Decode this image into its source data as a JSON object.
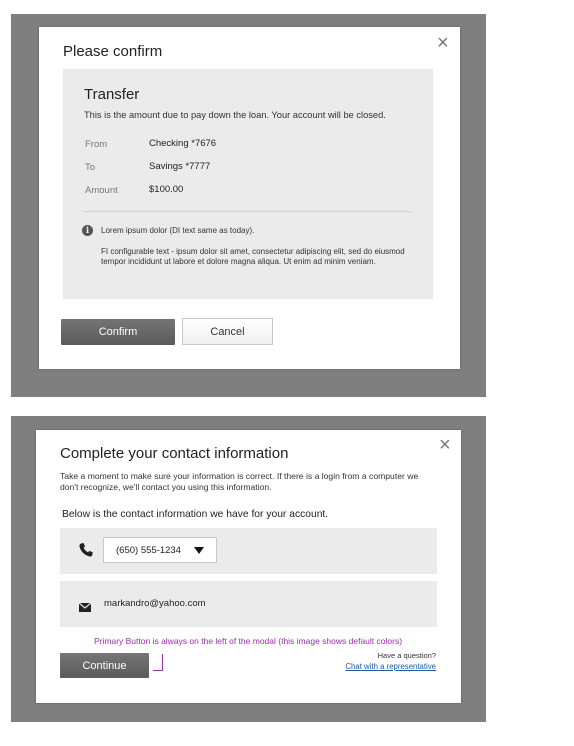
{
  "confirm_modal": {
    "title": "Please confirm",
    "close_symbol": "×",
    "panel_heading": "Transfer",
    "panel_subtitle": "This is the amount due to pay down the loan. Your account will be closed.",
    "rows": [
      {
        "label": "From",
        "value": "Checking *7676"
      },
      {
        "label": "To",
        "value": "Savings *7777"
      },
      {
        "label": "Amount",
        "value": "$100.00"
      }
    ],
    "info_line": "Lorem ipsum dolor (DI text same as today).",
    "info_paragraph": "FI configurable text  - ipsum dolor sit amet, consectetur adipiscing elit, sed do eiusmod tempor incididunt ut labore et dolore magna aliqua. Ut enim ad minim veniam.",
    "confirm_label": "Confirm",
    "cancel_label": "Cancel"
  },
  "contact_modal": {
    "title": "Complete your contact information",
    "close_symbol": "×",
    "intro": "Take a moment to make sure your information is correct. If there is a login from a computer we don't recognize, we'll contact you using this information.",
    "subheading": "Below is the contact information we have for your account.",
    "phone_value": "(650) 555-1234",
    "email_value": "markandro@yahoo.com",
    "annotation": "Primary Button is always on the left of the modal (this image shows default colors)",
    "continue_label": "Continue",
    "question_text": "Have a question?",
    "chat_link": "Chat with a representative"
  },
  "colors": {
    "backdrop": "#7f7f7f",
    "panel": "#ebebeb",
    "primary_button": "#666666",
    "annotation": "#9b2fae",
    "link": "#1a5ea8"
  }
}
